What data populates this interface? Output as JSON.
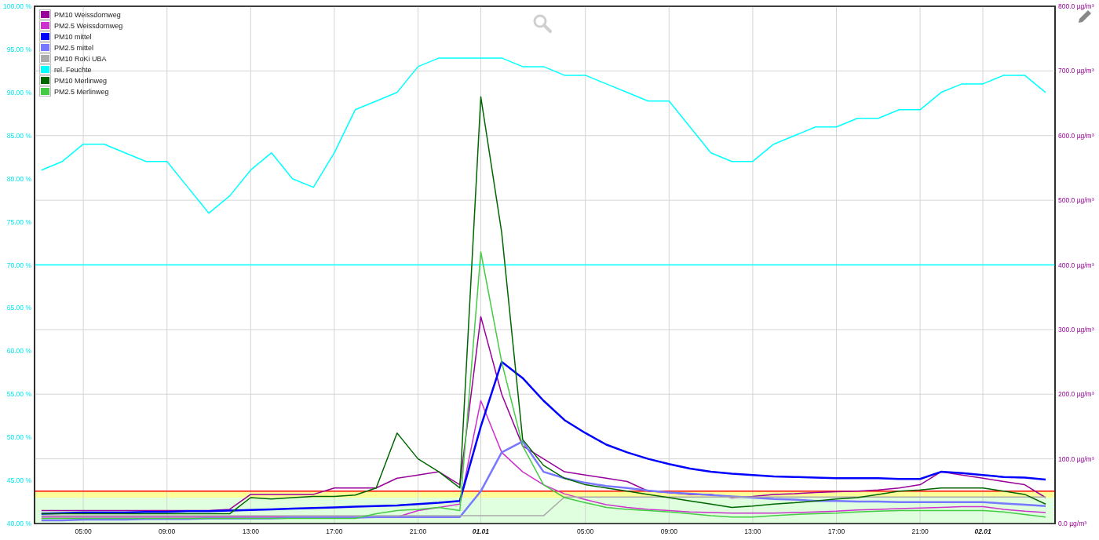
{
  "chart": {
    "chart_data": {
      "type": "line",
      "categories": [
        null,
        null,
        "05:00",
        null,
        null,
        null,
        "09:00",
        null,
        null,
        null,
        "13:00",
        null,
        null,
        null,
        "17:00",
        null,
        null,
        null,
        "21:00",
        null,
        null,
        "01.01",
        null,
        null,
        null,
        null,
        "05:00",
        null,
        null,
        null,
        "09:00",
        null,
        null,
        null,
        "13:00",
        null,
        null,
        null,
        "17:00",
        null,
        null,
        null,
        "21:00",
        null,
        null,
        "02.01",
        null,
        null,
        null
      ],
      "ylim": [
        40,
        100
      ],
      "yticks": [
        {
          "value": 40,
          "label": "40.00 %"
        },
        {
          "value": 45,
          "label": "45.00 %"
        },
        {
          "value": 50,
          "label": "50.00 %"
        },
        {
          "value": 55,
          "label": "55.00 %"
        },
        {
          "value": 60,
          "label": "60.00 %"
        },
        {
          "value": 65,
          "label": "65.00 %"
        },
        {
          "value": 70,
          "label": "70.00 %"
        },
        {
          "value": 75,
          "label": "75.00 %"
        },
        {
          "value": 80,
          "label": "80.00 %"
        },
        {
          "value": 85,
          "label": "85.00 %"
        },
        {
          "value": 90,
          "label": "90.00 %"
        },
        {
          "value": 95,
          "label": "95.00 %"
        },
        {
          "value": 100,
          "label": "100.00 %"
        }
      ],
      "grid": true,
      "legend": "upper left",
      "ref_lines": [
        {
          "axis": "y2",
          "value": 50,
          "color": "#ff0000"
        },
        {
          "axis": "y",
          "value": 70,
          "color": "#00ffff"
        }
      ],
      "bands": [
        {
          "axis": "y2",
          "from": 0,
          "to": 40,
          "color": "#dfffdf"
        },
        {
          "axis": "y2",
          "from": 40,
          "to": 50,
          "color": "#ffff99"
        }
      ],
      "y2lim": [
        0,
        800
      ],
      "y2ticks": [
        {
          "value": 0,
          "label": "0.0 µg/m³"
        },
        {
          "value": 100,
          "label": "100.0 µg/m³"
        },
        {
          "value": 200,
          "label": "200.0 µg/m³"
        },
        {
          "value": 300,
          "label": "300.0 µg/m³"
        },
        {
          "value": 400,
          "label": "400.0 µg/m³"
        },
        {
          "value": 500,
          "label": "500.0 µg/m³"
        },
        {
          "value": 600,
          "label": "600.0 µg/m³"
        },
        {
          "value": 700,
          "label": "700.0 µg/m³"
        },
        {
          "value": 800,
          "label": "800.0 µg/m³"
        }
      ],
      "series": [
        {
          "name": "PM10 Weissdornweg",
          "color": "#990099",
          "axis": "y2",
          "values": [
            20,
            20,
            20,
            20,
            20,
            20,
            20,
            20,
            20,
            22,
            45,
            45,
            45,
            45,
            55,
            55,
            55,
            70,
            75,
            80,
            60,
            320,
            200,
            120,
            100,
            80,
            75,
            70,
            65,
            50,
            48,
            45,
            45,
            40,
            42,
            45,
            46,
            48,
            49,
            50,
            52,
            55,
            60,
            80,
            75,
            70,
            65,
            60,
            40
          ]
        },
        {
          "name": "PM2.5 Weissdornweg",
          "color": "#cc33cc",
          "axis": "y2",
          "values": [
            10,
            10,
            10,
            10,
            10,
            10,
            10,
            10,
            10,
            10,
            10,
            10,
            10,
            10,
            10,
            10,
            10,
            10,
            20,
            25,
            30,
            190,
            110,
            80,
            60,
            46,
            37,
            29,
            25,
            22,
            20,
            18,
            17,
            16,
            16,
            16,
            17,
            18,
            19,
            21,
            22,
            23,
            24,
            25,
            26,
            26,
            22,
            19,
            17
          ]
        },
        {
          "name": "PM10 mittel",
          "color": "#0000ff",
          "axis": "y2",
          "values": [
            15,
            16,
            17,
            17,
            17,
            18,
            18,
            19,
            19,
            20,
            21,
            22,
            23,
            24,
            25,
            26,
            27,
            28,
            30,
            32,
            35,
            150,
            250,
            225,
            190,
            160,
            140,
            122,
            110,
            100,
            92,
            85,
            80,
            77,
            75,
            73,
            72,
            71,
            70,
            70,
            70,
            69,
            69,
            80,
            78,
            75,
            72,
            71,
            68
          ]
        },
        {
          "name": "PM2.5 mittel",
          "color": "#7777ff",
          "axis": "y2",
          "values": [
            5,
            5,
            6,
            6,
            6,
            7,
            7,
            7,
            8,
            8,
            8,
            8,
            9,
            9,
            9,
            9,
            10,
            10,
            10,
            10,
            10,
            50,
            110,
            127,
            80,
            70,
            63,
            58,
            55,
            51,
            48,
            46,
            44,
            42,
            40,
            38,
            37,
            35,
            35,
            34,
            34,
            33,
            33,
            33,
            33,
            33,
            31,
            29,
            27
          ]
        },
        {
          "name": "PM10 RoKi UBA",
          "color": "#aaaaaa",
          "axis": "y2",
          "values": [
            12,
            12,
            12,
            12,
            12,
            12,
            12,
            12,
            12,
            12,
            12,
            12,
            12,
            12,
            12,
            12,
            12,
            12,
            12,
            12,
            12,
            12,
            12,
            12,
            12,
            41,
            41,
            41,
            41,
            41,
            41,
            41,
            41,
            41,
            41,
            41,
            41,
            41,
            41,
            41,
            41,
            41,
            41,
            41,
            41,
            41,
            41,
            41,
            41
          ]
        },
        {
          "name": "rel. Feuchte",
          "color": "#00ffff",
          "values": [
            81,
            82,
            84,
            84,
            83,
            82,
            82,
            79,
            76,
            78,
            81,
            83,
            80,
            79,
            83,
            88,
            89,
            90,
            93,
            94,
            94,
            94,
            94,
            93,
            93,
            92,
            92,
            91,
            90,
            89,
            89,
            86,
            83,
            82,
            82,
            84,
            85,
            86,
            86,
            87,
            87,
            88,
            88,
            90,
            91,
            91,
            92,
            92,
            90
          ]
        },
        {
          "name": "PM10 Merlinweg",
          "color": "#006600",
          "axis": "y2",
          "values": [
            15,
            15,
            15,
            15,
            15,
            15,
            15,
            15,
            15,
            15,
            40,
            38,
            40,
            42,
            42,
            44,
            55,
            140,
            100,
            80,
            55,
            660,
            450,
            130,
            90,
            70,
            60,
            55,
            50,
            45,
            40,
            35,
            30,
            25,
            27,
            30,
            32,
            35,
            38,
            40,
            45,
            50,
            52,
            55,
            55,
            55,
            50,
            45,
            30
          ]
        },
        {
          "name": "PM2.5 Merlinweg",
          "color": "#44cc44",
          "axis": "y2",
          "values": [
            8,
            8,
            8,
            8,
            8,
            8,
            8,
            8,
            8,
            8,
            8,
            8,
            8,
            8,
            8,
            8,
            15,
            20,
            22,
            25,
            20,
            420,
            250,
            120,
            60,
            40,
            32,
            25,
            22,
            20,
            18,
            15,
            12,
            10,
            10,
            12,
            14,
            15,
            16,
            18,
            19,
            20,
            20,
            20,
            20,
            20,
            18,
            14,
            10
          ]
        }
      ]
    },
    "date_labels": [
      false,
      false,
      false,
      false,
      false,
      true,
      false,
      false,
      false,
      false,
      false,
      true
    ]
  }
}
